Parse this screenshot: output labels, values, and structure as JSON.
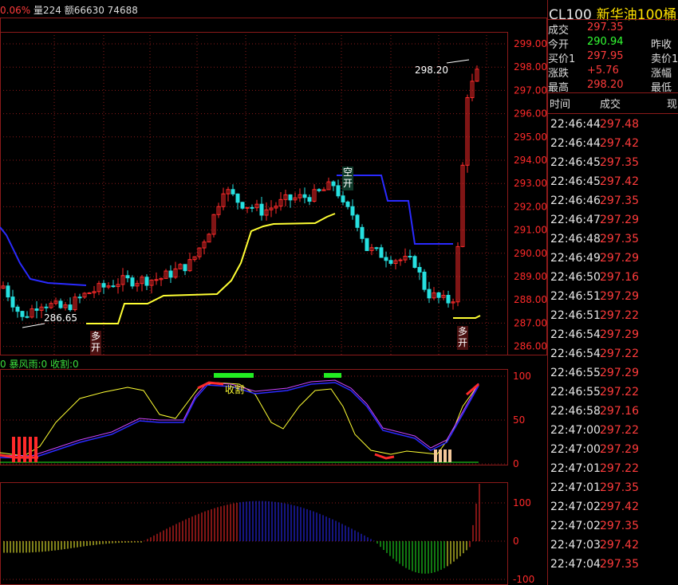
{
  "top_bar": {
    "change": "0.06%",
    "volume": "量224",
    "amount": "额66630 74688"
  },
  "indicator_label": {
    "prefix": "0",
    "storm": "暴风雨:0",
    "harvest": "收割:0"
  },
  "chart_annotations": {
    "high_label": "298.20",
    "low_label": "286.65",
    "signal_long_1": [
      "多",
      "开"
    ],
    "signal_short": [
      "空",
      "开"
    ],
    "signal_long_2": [
      "多",
      "开"
    ],
    "harvest_text": "收割"
  },
  "price_axis": [
    "299.00",
    "298.00",
    "297.00",
    "296.00",
    "295.00",
    "294.00",
    "293.00",
    "292.00",
    "291.00",
    "290.00",
    "289.00",
    "288.00",
    "287.00",
    "286.00"
  ],
  "osc_axis": [
    "100",
    "50",
    "0"
  ],
  "macd_axis": [
    "100",
    "0",
    "-100"
  ],
  "panel": {
    "code": "CL100",
    "name": "新华油100桶",
    "quote": [
      {
        "label": "成交",
        "value": "297.35",
        "color": "red",
        "right": ""
      },
      {
        "label": "今开",
        "value": "290.94",
        "color": "green",
        "right": "昨收"
      },
      {
        "label": "买价1",
        "value": "297.95",
        "color": "red",
        "right": "卖价1"
      },
      {
        "label": "涨跌",
        "value": "+5.76",
        "color": "red",
        "right": "涨幅"
      },
      {
        "label": "最高",
        "value": "298.20",
        "color": "red",
        "right": "最低"
      }
    ],
    "headers": [
      "时间",
      "成交",
      "现"
    ],
    "ticks": [
      {
        "time": "22:46:44",
        "price": "297.48"
      },
      {
        "time": "22:46:44",
        "price": "297.42"
      },
      {
        "time": "22:46:45",
        "price": "297.35"
      },
      {
        "time": "22:46:45",
        "price": "297.42"
      },
      {
        "time": "22:46:46",
        "price": "297.35"
      },
      {
        "time": "22:46:47",
        "price": "297.29"
      },
      {
        "time": "22:46:48",
        "price": "297.35"
      },
      {
        "time": "22:46:49",
        "price": "297.29"
      },
      {
        "time": "22:46:50",
        "price": "297.16"
      },
      {
        "time": "22:46:51",
        "price": "297.29"
      },
      {
        "time": "22:46:51",
        "price": "297.22"
      },
      {
        "time": "22:46:54",
        "price": "297.29"
      },
      {
        "time": "22:46:54",
        "price": "297.22"
      },
      {
        "time": "22:46:55",
        "price": "297.29"
      },
      {
        "time": "22:46:55",
        "price": "297.22"
      },
      {
        "time": "22:46:58",
        "price": "297.16"
      },
      {
        "time": "22:47:00",
        "price": "297.22"
      },
      {
        "time": "22:47:00",
        "price": "297.29"
      },
      {
        "time": "22:47:01",
        "price": "297.22"
      },
      {
        "time": "22:47:01",
        "price": "297.35"
      },
      {
        "time": "22:47:02",
        "price": "297.42"
      },
      {
        "time": "22:47:02",
        "price": "297.35"
      },
      {
        "time": "22:47:03",
        "price": "297.42"
      },
      {
        "time": "22:47:04",
        "price": "297.35"
      }
    ]
  },
  "colors": {
    "up": "#ff2a2a",
    "down": "#26e0e0",
    "grid": "#8b1a1a",
    "blue": "#2a2aff",
    "yellow": "#ffff33",
    "white": "#ffffff",
    "green": "#22ee22"
  }
}
